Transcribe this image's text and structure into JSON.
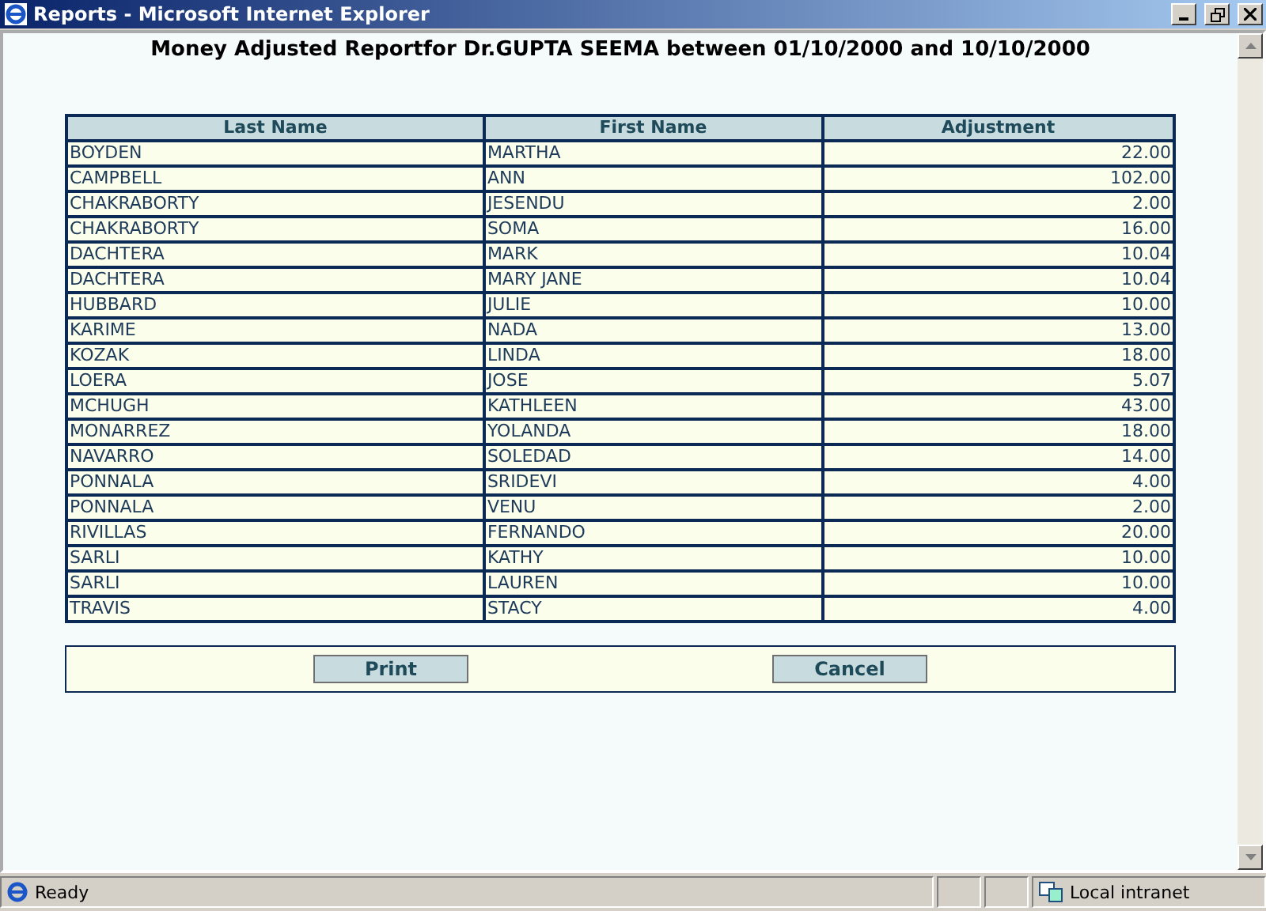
{
  "window": {
    "title": "Reports - Microsoft Internet Explorer"
  },
  "report": {
    "title": "Money Adjusted Reportfor Dr.GUPTA SEEMA between 01/10/2000 and 10/10/2000"
  },
  "table": {
    "columns": [
      "Last Name",
      "First Name",
      "Adjustment"
    ],
    "rows": [
      [
        "BOYDEN",
        "MARTHA",
        "22.00"
      ],
      [
        "CAMPBELL",
        "ANN",
        "102.00"
      ],
      [
        "CHAKRABORTY",
        "JESENDU",
        "2.00"
      ],
      [
        "CHAKRABORTY",
        "SOMA",
        "16.00"
      ],
      [
        "DACHTERA",
        "MARK",
        "10.04"
      ],
      [
        "DACHTERA",
        "MARY JANE",
        "10.04"
      ],
      [
        "HUBBARD",
        "JULIE",
        "10.00"
      ],
      [
        "KARIME",
        "NADA",
        "13.00"
      ],
      [
        "KOZAK",
        "LINDA",
        "18.00"
      ],
      [
        "LOERA",
        "JOSE",
        "5.07"
      ],
      [
        "MCHUGH",
        "KATHLEEN",
        "43.00"
      ],
      [
        "MONARREZ",
        "YOLANDA",
        "18.00"
      ],
      [
        "NAVARRO",
        "SOLEDAD",
        "14.00"
      ],
      [
        "PONNALA",
        "SRIDEVI",
        "4.00"
      ],
      [
        "PONNALA",
        "VENU",
        "2.00"
      ],
      [
        "RIVILLAS",
        "FERNANDO",
        "20.00"
      ],
      [
        "SARLI",
        "KATHY",
        "10.00"
      ],
      [
        "SARLI",
        "LAUREN",
        "10.00"
      ],
      [
        "TRAVIS",
        "STACY",
        "4.00"
      ]
    ]
  },
  "buttons": [
    "Print",
    "Cancel"
  ],
  "status_bar": {
    "text": "Ready",
    "zone": "Local intranet"
  }
}
